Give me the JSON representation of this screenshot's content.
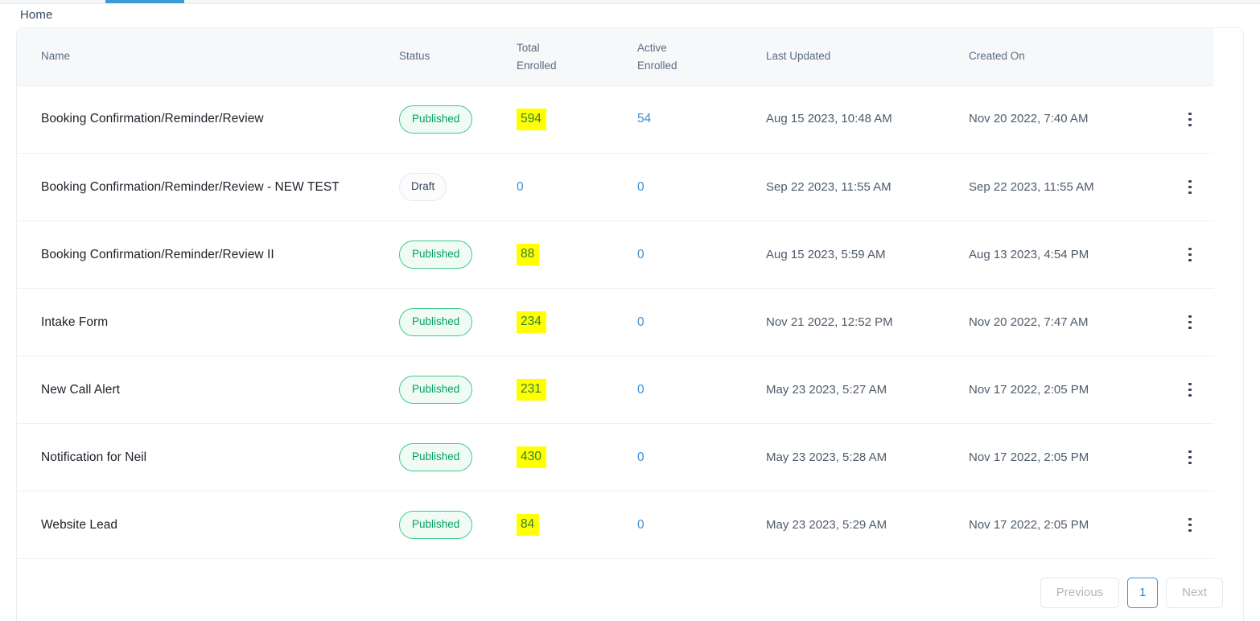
{
  "topbar": {
    "active_tab_accent": "#3d9ad4"
  },
  "breadcrumb": {
    "home_label": "Home"
  },
  "table": {
    "columns": {
      "name": "Name",
      "status": "Status",
      "total_enrolled_line1": "Total",
      "total_enrolled_line2": "Enrolled",
      "active_enrolled_line1": "Active",
      "active_enrolled_line2": "Enrolled",
      "last_updated": "Last Updated",
      "created_on": "Created On"
    },
    "rows": [
      {
        "name": "Booking Confirmation/Reminder/Review",
        "status": "Published",
        "status_type": "published",
        "total_enrolled": "594",
        "total_highlighted": true,
        "active_enrolled": "54",
        "last_updated": "Aug 15 2023, 10:48 AM",
        "created_on": "Nov 20 2022, 7:40 AM"
      },
      {
        "name": "Booking Confirmation/Reminder/Review - NEW TEST",
        "status": "Draft",
        "status_type": "draft",
        "total_enrolled": "0",
        "total_highlighted": false,
        "active_enrolled": "0",
        "last_updated": "Sep 22 2023, 11:55 AM",
        "created_on": "Sep 22 2023, 11:55 AM"
      },
      {
        "name": "Booking Confirmation/Reminder/Review II",
        "status": "Published",
        "status_type": "published",
        "total_enrolled": "88",
        "total_highlighted": true,
        "active_enrolled": "0",
        "last_updated": "Aug 15 2023, 5:59 AM",
        "created_on": "Aug 13 2023, 4:54 PM"
      },
      {
        "name": "Intake Form",
        "status": "Published",
        "status_type": "published",
        "total_enrolled": "234",
        "total_highlighted": true,
        "active_enrolled": "0",
        "last_updated": "Nov 21 2022, 12:52 PM",
        "created_on": "Nov 20 2022, 7:47 AM"
      },
      {
        "name": "New Call Alert",
        "status": "Published",
        "status_type": "published",
        "total_enrolled": "231",
        "total_highlighted": true,
        "active_enrolled": "0",
        "last_updated": "May 23 2023, 5:27 AM",
        "created_on": "Nov 17 2022, 2:05 PM"
      },
      {
        "name": "Notification for Neil",
        "status": "Published",
        "status_type": "published",
        "total_enrolled": "430",
        "total_highlighted": true,
        "active_enrolled": "0",
        "last_updated": "May 23 2023, 5:28 AM",
        "created_on": "Nov 17 2022, 2:05 PM"
      },
      {
        "name": "Website Lead",
        "status": "Published",
        "status_type": "published",
        "total_enrolled": "84",
        "total_highlighted": true,
        "active_enrolled": "0",
        "last_updated": "May 23 2023, 5:29 AM",
        "created_on": "Nov 17 2022, 2:05 PM"
      }
    ],
    "row_menu_icon": "kebab-menu-icon"
  },
  "pagination": {
    "previous_label": "Previous",
    "next_label": "Next",
    "current_page": "1"
  },
  "colors": {
    "link": "#3d8fd6",
    "highlight": "#ffff00",
    "published_green": "#00a060",
    "tab_accent": "#3d9ad4"
  }
}
